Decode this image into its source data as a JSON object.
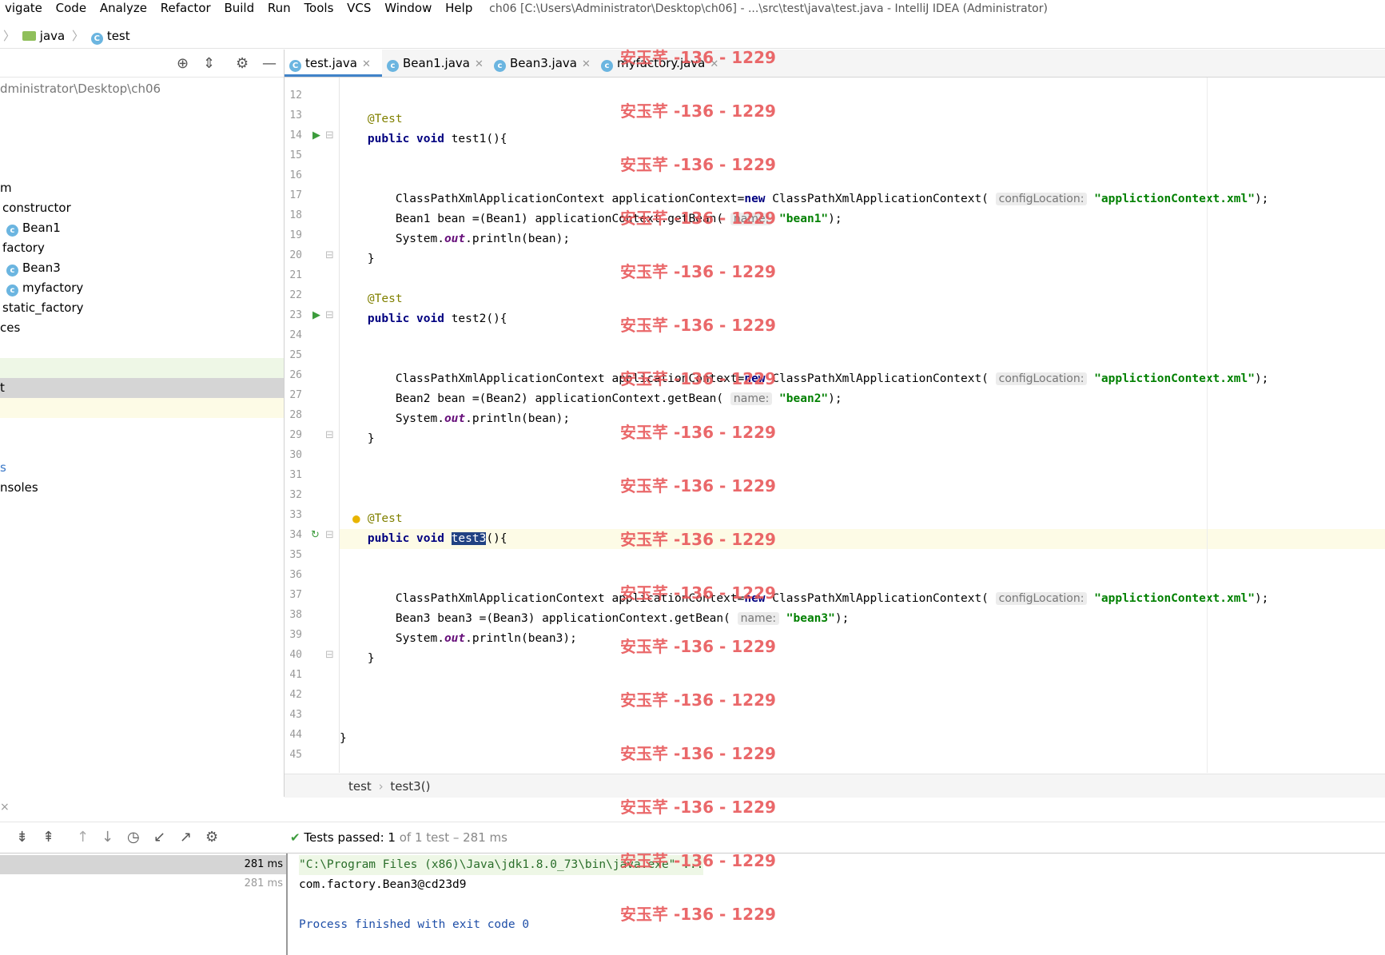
{
  "menu": {
    "items": [
      "vigate",
      "Code",
      "Analyze",
      "Refactor",
      "Build",
      "Run",
      "Tools",
      "VCS",
      "Window",
      "Help"
    ],
    "window_title": "ch06 [C:\\Users\\Administrator\\Desktop\\ch06] - ...\\src\\test\\java\\test.java - IntelliJ IDEA (Administrator)"
  },
  "navbar": {
    "crumbs": [
      "java",
      "test"
    ]
  },
  "project": {
    "root_path": "dministrator\\Desktop\\ch06",
    "tree": [
      "m",
      "constructor",
      "Bean1",
      "factory",
      "Bean3",
      "myfactory",
      "static_factory",
      "ces",
      "t",
      "s",
      "nsoles"
    ]
  },
  "tabs": [
    {
      "label": "test.java",
      "active": true
    },
    {
      "label": "Bean1.java",
      "active": false
    },
    {
      "label": "Bean3.java",
      "active": false
    },
    {
      "label": "myfactory.java",
      "active": false
    }
  ],
  "code": {
    "line_numbers": [
      "12",
      "13",
      "14",
      "15",
      "16",
      "17",
      "18",
      "19",
      "20",
      "21",
      "22",
      "23",
      "24",
      "25",
      "26",
      "27",
      "28",
      "29",
      "30",
      "31",
      "32",
      "33",
      "34",
      "35",
      "36",
      "37",
      "38",
      "39",
      "40",
      "41",
      "42",
      "43",
      "44",
      "45"
    ],
    "annotation": "@Test",
    "kw_public": "public",
    "kw_void": "void",
    "kw_new": "new",
    "test1_sig": "test1(){",
    "test2_sig": "test2(){",
    "test3_name": "test3",
    "test3_rest": "(){",
    "ctx_decl": "ClassPathXmlApplicationContext applicationContext=",
    "ctx_new": " ClassPathXmlApplicationContext(",
    "hint_config": "configLocation:",
    "hint_name": "name:",
    "xml_str": "\"applictionContext.xml\"",
    "end_call": ");",
    "bean1_line": "Bean1 bean =(Bean1) applicationContext.getBean(",
    "bean1_str": "\"bean1\"",
    "bean2_line": "Bean2 bean =(Bean2) applicationContext.getBean(",
    "bean2_str": "\"bean2\"",
    "bean3_line": "Bean3 bean3 =(Bean3) applicationContext.getBean(",
    "bean3_str": "\"bean3\"",
    "print_pre": "System.",
    "print_out": "out",
    "print_bean": ".println(bean);",
    "print_bean3": ".println(bean3);",
    "close_brace": "}"
  },
  "editor_breadcrumb": {
    "class_name": "test",
    "method_name": "test3()"
  },
  "run": {
    "status_label": "Tests passed:",
    "status_count": "1",
    "status_rest": "of 1 test – 281 ms",
    "time_1": "281 ms",
    "time_2": "281 ms",
    "console": [
      "\"C:\\Program Files (x86)\\Java\\jdk1.8.0_73\\bin\\java.exe\" ...",
      "com.factory.Bean3@cd23d9",
      "",
      "Process finished with exit code 0"
    ]
  },
  "watermark": "安玉芊 -136 - 1229",
  "colors": {
    "accent": "#4083c9",
    "keyword": "#000080",
    "string": "#008000",
    "annotation": "#808000",
    "watermark": "#e8585a"
  }
}
